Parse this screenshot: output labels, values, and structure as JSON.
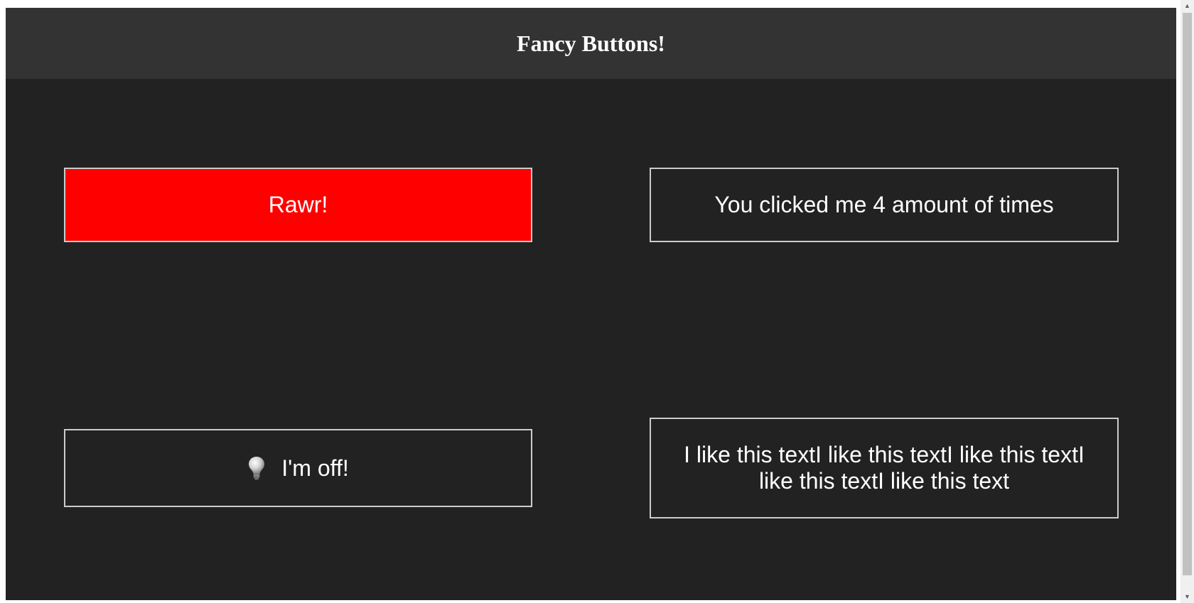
{
  "header": {
    "title": "Fancy Buttons!"
  },
  "buttons": {
    "rawr": {
      "label": "Rawr!",
      "color": "#ff0000"
    },
    "counter": {
      "label": "You clicked me 4 amount of times"
    },
    "light": {
      "label": "I'm off!",
      "icon": "lightbulb-icon"
    },
    "text": {
      "label": "I like this textI like this textI like this textI like this textI like this text"
    }
  },
  "colors": {
    "page_bg": "#222222",
    "header_bg": "#333333",
    "button_border": "#cccccc",
    "text": "#ffffff"
  }
}
